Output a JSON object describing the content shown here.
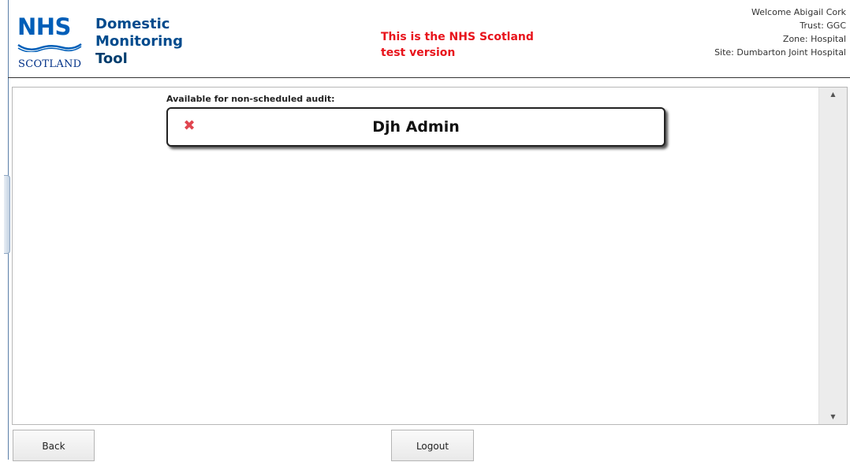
{
  "header": {
    "logo_nhs": "NHS",
    "logo_scotland": "SCOTLAND",
    "app_title_lines": [
      "Domestic",
      "Monitoring",
      "Tool"
    ],
    "test_banner_lines": [
      "This is the NHS Scotland",
      "test version"
    ],
    "user": {
      "welcome": "Welcome Abigail Cork",
      "trust": "Trust: GGC",
      "zone": "Zone: Hospital",
      "site": "Site: Dumbarton Joint Hospital"
    }
  },
  "main": {
    "section_label": "Available for non-scheduled audit:",
    "items": [
      {
        "name": "Djh Admin",
        "icon": "remove-icon"
      }
    ]
  },
  "footer": {
    "back_label": "Back",
    "logout_label": "Logout"
  },
  "colors": {
    "nhs_blue": "#005eb8",
    "test_banner": "#e8141c",
    "remove_icon": "#e0454f"
  }
}
